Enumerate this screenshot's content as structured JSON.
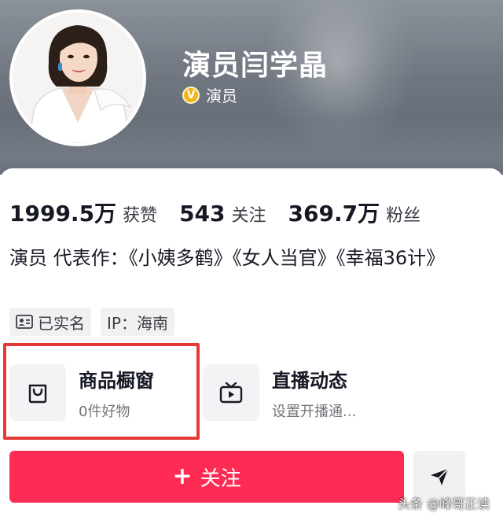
{
  "profile": {
    "name": "演员闫学晶",
    "verified_label": "演员",
    "verified_badge_text": "V"
  },
  "stats": [
    {
      "value": "1999.5万",
      "label": "获赞"
    },
    {
      "value": "543",
      "label": "关注"
    },
    {
      "value": "369.7万",
      "label": "粉丝"
    }
  ],
  "bio": "演员 代表作：《小姨多鹤》《女人当官》《幸福36计》",
  "tags": [
    {
      "icon": "id-card-icon",
      "label": "已实名"
    },
    {
      "label": "IP：海南"
    }
  ],
  "tools": [
    {
      "icon": "shopping-bag-icon",
      "title": "商品橱窗",
      "subtitle": "0件好物"
    },
    {
      "icon": "tv-play-icon",
      "title": "直播动态",
      "subtitle": "设置开播通..."
    }
  ],
  "actions": {
    "follow_icon": "+",
    "follow_label": "关注",
    "share_icon": "send-icon"
  },
  "watermark": "头条 @峰哥正读",
  "colors": {
    "follow_button": "#fe2c55",
    "highlight_box": "#e53935",
    "verified_badge": "#f2b51c"
  }
}
